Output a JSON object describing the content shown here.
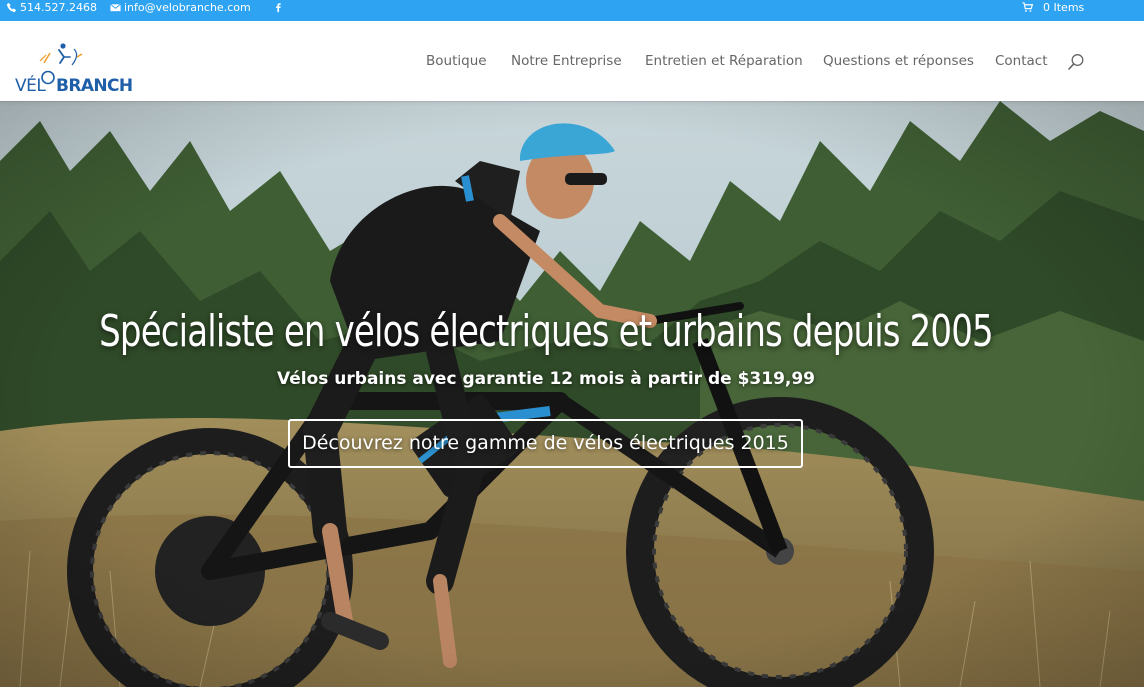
{
  "topbar": {
    "phone": "514.527.2468",
    "email": "info@velobranche.com",
    "cart": "0 Items",
    "colors": {
      "background": "#2ea3f2",
      "text": "#ffffff"
    }
  },
  "header": {
    "logo": {
      "part1": "VÉL",
      "part2": "BRANCHE"
    },
    "nav": [
      {
        "label": "Boutique"
      },
      {
        "label": "Notre Entreprise"
      },
      {
        "label": "Entretien et Réparation"
      },
      {
        "label": "Questions et réponses"
      },
      {
        "label": "Contact"
      }
    ],
    "search_icon": "search-icon"
  },
  "hero": {
    "title": "Spécialiste en vélos électriques et urbains depuis 2005",
    "subtitle": "Vélos urbains avec garantie 12 mois à partir de $319,99",
    "button_label": "Découvrez notre gamme de vélos électriques 2015"
  },
  "colors": {
    "accent": "#2ea3f2",
    "logo_blue": "#1f5fa8",
    "logo_orange": "#f29a1f"
  }
}
